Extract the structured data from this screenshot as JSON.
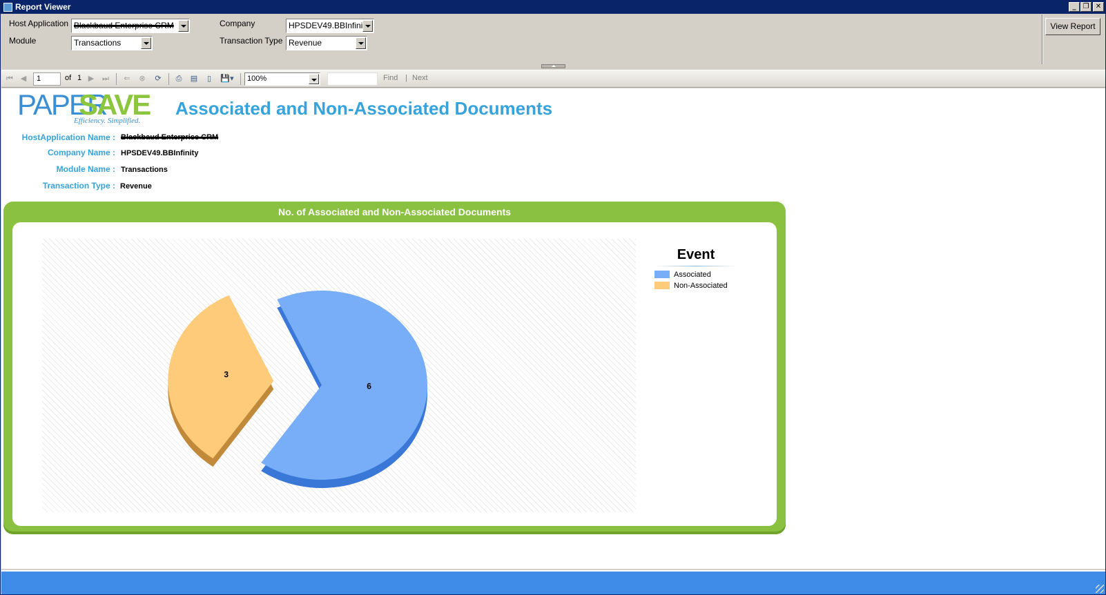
{
  "window": {
    "title": "Report Viewer"
  },
  "params": {
    "host_application_label": "Host Application",
    "host_application_value": "Blackbaud Enterprise CRM",
    "module_label": "Module",
    "module_value": "Transactions",
    "company_label": "Company",
    "company_value": "HPSDEV49.BBInfinity",
    "transaction_type_label": "Transaction Type",
    "transaction_type_value": "Revenue",
    "view_report_label": "View Report"
  },
  "toolbar": {
    "page_current": "1",
    "page_of": "of",
    "page_total": "1",
    "zoom": "100%",
    "find_label": "Find",
    "next_label": "Next",
    "find_text": ""
  },
  "report": {
    "logo_paper": "PAPER",
    "logo_save": "SAVE",
    "logo_tagline": "Efficiency. Simplified.",
    "title": "Associated and Non-Associated Documents",
    "meta": {
      "host_label": "HostApplication Name :",
      "host_value": "Blackbaud Enterprise CRM",
      "company_label": "Company Name :",
      "company_value": "HPSDEV49.BBInfinity",
      "module_label": "Module Name :",
      "module_value": "Transactions",
      "ttype_label": "Transaction Type :",
      "ttype_value": "Revenue"
    }
  },
  "chart_data": {
    "type": "pie",
    "title": "No. of Associated and Non-Associated Documents",
    "legend_title": "Event",
    "legend_position": "right",
    "slices": [
      {
        "name": "Associated",
        "value": 6,
        "color": "#78aef8",
        "side_color": "#3a78d8"
      },
      {
        "name": "Non-Associated",
        "value": 3,
        "color": "#fecb7a",
        "side_color": "#c08a3a"
      }
    ],
    "exploded": "Non-Associated",
    "style": "3d"
  },
  "colors": {
    "accent_blue": "#36a3dc",
    "frame_green": "#8ac140",
    "status_blue": "#3f8ce8"
  }
}
